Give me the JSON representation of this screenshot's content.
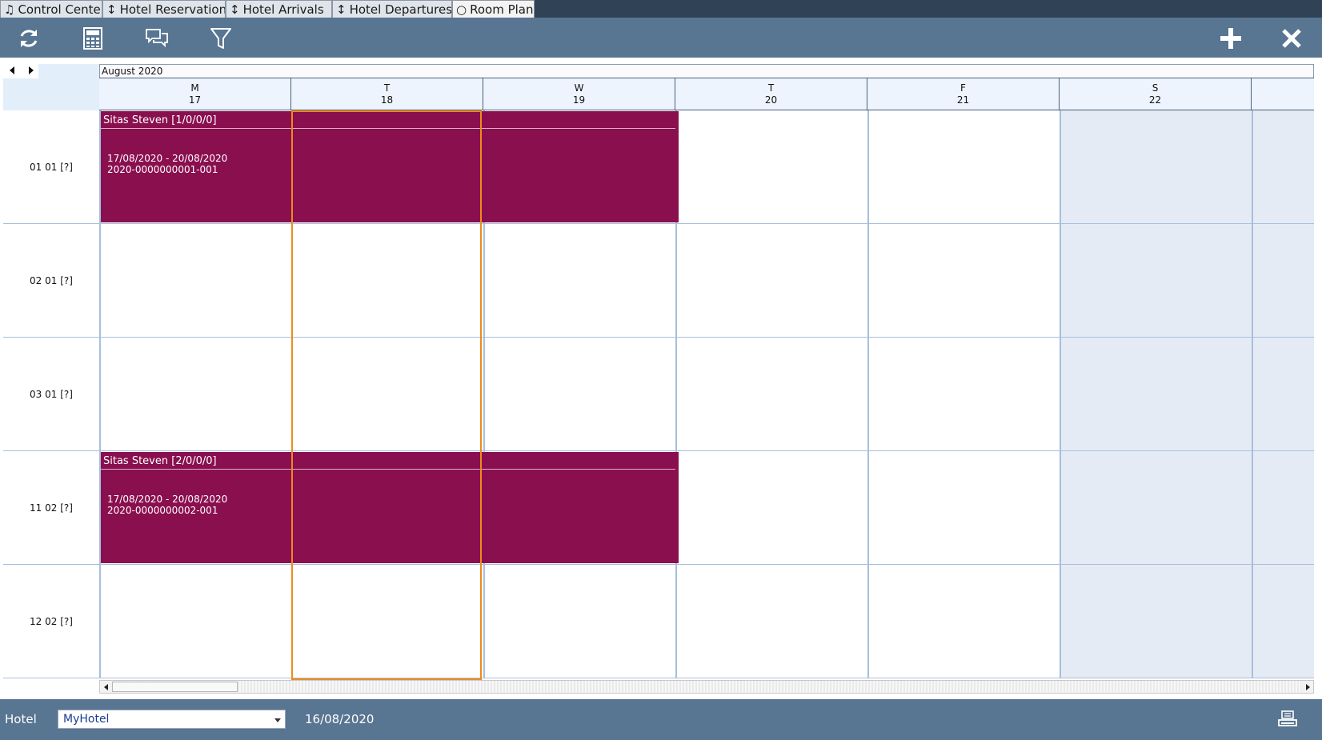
{
  "tabs": [
    {
      "icon": "♫",
      "label": "Control Center"
    },
    {
      "icon": "↕",
      "label": "Hotel Reservations"
    },
    {
      "icon": "↕",
      "label": "Hotel Arrivals"
    },
    {
      "icon": "↕",
      "label": "Hotel Departures"
    },
    {
      "icon": "○",
      "label": "Room Plan"
    }
  ],
  "toolbar": {
    "left_icons": [
      "refresh-icon",
      "calculator-icon",
      "chat-icon",
      "filter-icon"
    ],
    "right_icons": [
      "plus-icon",
      "close-icon"
    ]
  },
  "calendar": {
    "month": "August 2020",
    "days": [
      {
        "dow": "M",
        "num": "17"
      },
      {
        "dow": "T",
        "num": "18"
      },
      {
        "dow": "W",
        "num": "19"
      },
      {
        "dow": "T",
        "num": "20"
      },
      {
        "dow": "F",
        "num": "21"
      },
      {
        "dow": "S",
        "num": "22"
      }
    ],
    "rooms": [
      "01 01 [?]",
      "02 01 [?]",
      "03 01 [?]",
      "11 02 [?]",
      "12 02 [?]"
    ],
    "bookings": [
      {
        "guest": "Sitas Steven [1/0/0/0]",
        "dates": "17/08/2020 - 20/08/2020",
        "number": "2020-0000000001-001"
      },
      {
        "guest": "Sitas Steven [2/0/0/0]",
        "dates": "17/08/2020 - 20/08/2020",
        "number": "2020-0000000002-001"
      }
    ]
  },
  "footer": {
    "hotel_label": "Hotel",
    "hotel_value": "MyHotel",
    "date": "16/08/2020"
  },
  "colors": {
    "booking": "#8a0f4f",
    "today_outline": "#f08a1c",
    "toolbar": "#587591"
  }
}
